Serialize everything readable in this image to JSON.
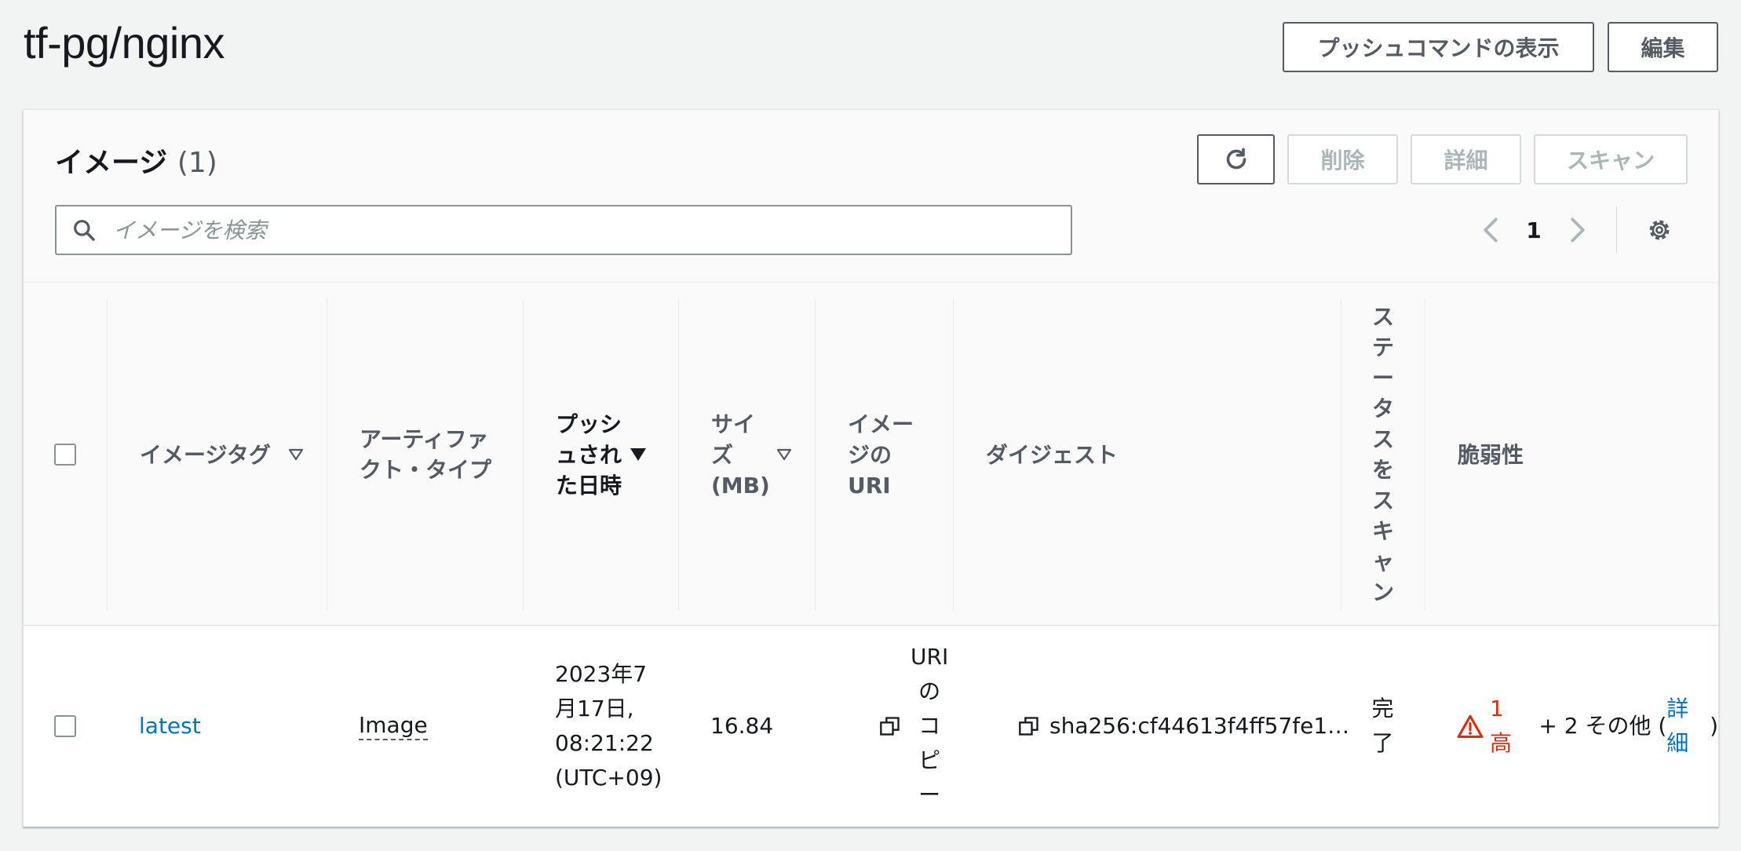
{
  "page": {
    "title": "tf-pg/nginx",
    "push_commands_label": "プッシュコマンドの表示",
    "edit_label": "編集"
  },
  "images_panel": {
    "title": "イメージ",
    "count": "(1)",
    "refresh_icon": "refresh-icon",
    "delete_label": "削除",
    "details_label": "詳細",
    "scan_label": "スキャン",
    "search": {
      "placeholder": "イメージを検索",
      "value": ""
    },
    "pagination": {
      "current_page": "1"
    },
    "settings_icon": "gear-icon"
  },
  "table": {
    "columns": {
      "image_tag": "イメージタグ",
      "artifact_type_l1": "アーティファ",
      "artifact_type_l2": "クト・タイプ",
      "pushed_at_l1": "プッシ",
      "pushed_at_l2": "ュされ",
      "pushed_at_l3": "た日時",
      "size_l1": "サイ",
      "size_l2": "ズ",
      "size_l3": "(MB)",
      "uri_l1": "イメー",
      "uri_l2": "ジの",
      "uri_l3": "URI",
      "digest": "ダイジェスト",
      "scan_status_chars": [
        "ス",
        "テ",
        "ー",
        "タ",
        "ス",
        "を",
        "ス",
        "キ",
        "ャ",
        "ン"
      ],
      "vulnerabilities": "脆弱性"
    },
    "rows": [
      {
        "tag": "latest",
        "artifact_type": "Image",
        "pushed_l1": "2023年7",
        "pushed_l2": "月17日,",
        "pushed_l3": "08:21:22",
        "pushed_l4": "(UTC+09)",
        "size": "16.84",
        "copy_uri_chars": [
          "URI",
          "の",
          "コ",
          "ピ",
          "ー"
        ],
        "digest": "sha256:cf44613f4ff57fe1…",
        "scan_status_chars": [
          "完",
          "了"
        ],
        "vuln_high": "1 高",
        "vuln_more": " + 2 その他 (",
        "vuln_details": "詳細",
        "vuln_close": ")"
      }
    ]
  },
  "colors": {
    "accent": "#0073bb",
    "high_severity": "#d13212",
    "border": "#545b64"
  }
}
